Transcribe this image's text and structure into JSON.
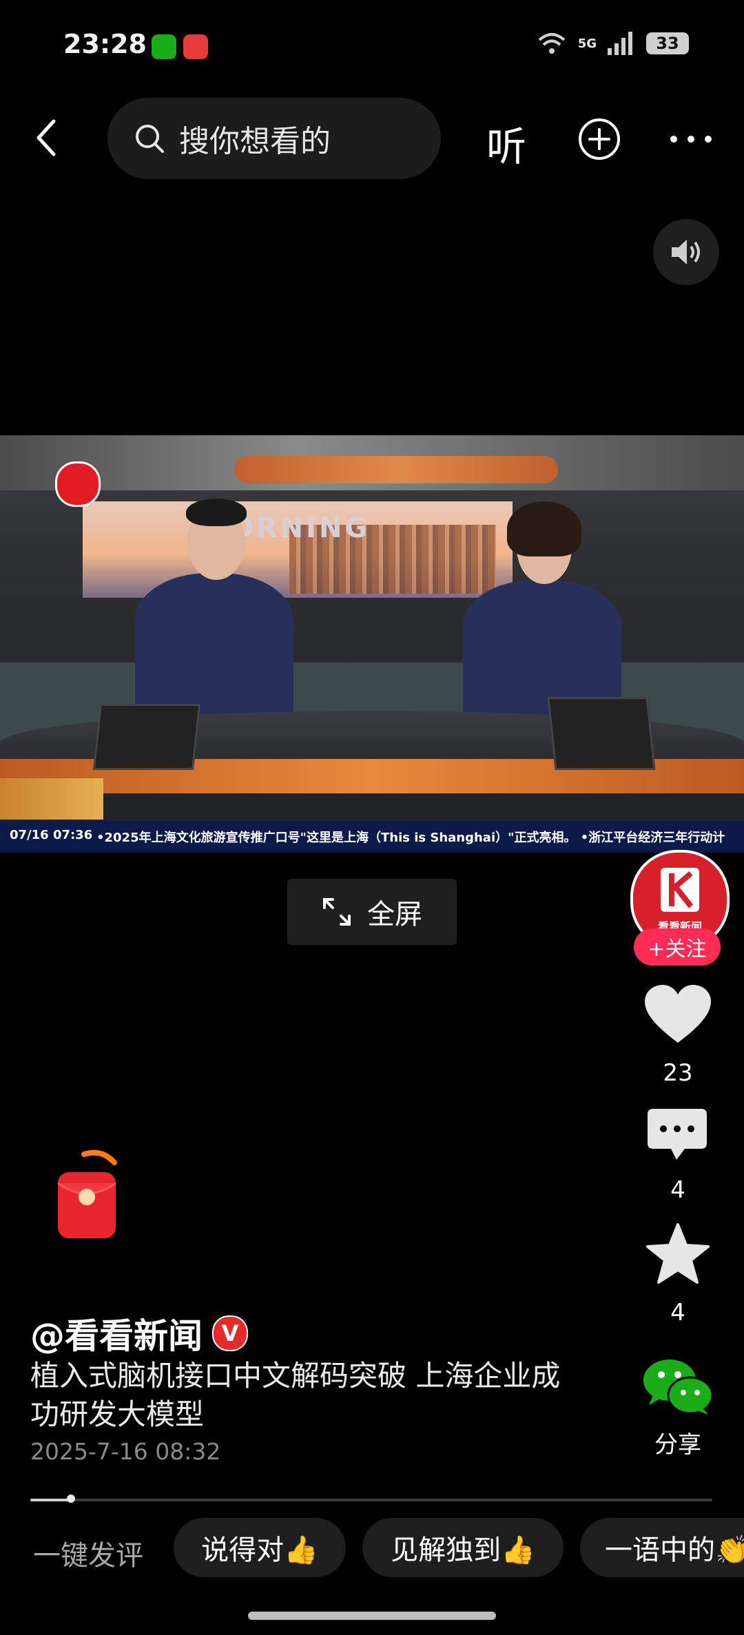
{
  "status_bar": {
    "time": "23:28",
    "network": "5G",
    "battery": "33"
  },
  "top_bar": {
    "search_placeholder": "搜你想看的",
    "listen_label": "听"
  },
  "video": {
    "ticker_date": "07/16 07:36",
    "ticker_text": "•2025年上海文化旅游宣传推广口号\"这里是上海（This is Shanghai）\"正式亮相。   •浙江平台经济三年行动计",
    "screen_text": "MORNING",
    "fullscreen_label": "全屏"
  },
  "rail": {
    "avatar_text": "看看新闻",
    "follow_label": "+关注",
    "likes": "23",
    "comments": "4",
    "favorites": "4",
    "share_label": "分享"
  },
  "post": {
    "author": "@看看新闻",
    "verified": "V",
    "caption": "植入式脑机接口中文解码突破 上海企业成功研发大模型",
    "timestamp": "2025-7-16 08:32",
    "progress": 0.06
  },
  "quick_comments": {
    "label": "一键发评",
    "chips": [
      "说得对👍",
      "见解独到👍",
      "一语中的👏"
    ]
  },
  "colors": {
    "accent": "#fe2c55",
    "background": "#000000",
    "wechat_green": "#1aad19"
  }
}
